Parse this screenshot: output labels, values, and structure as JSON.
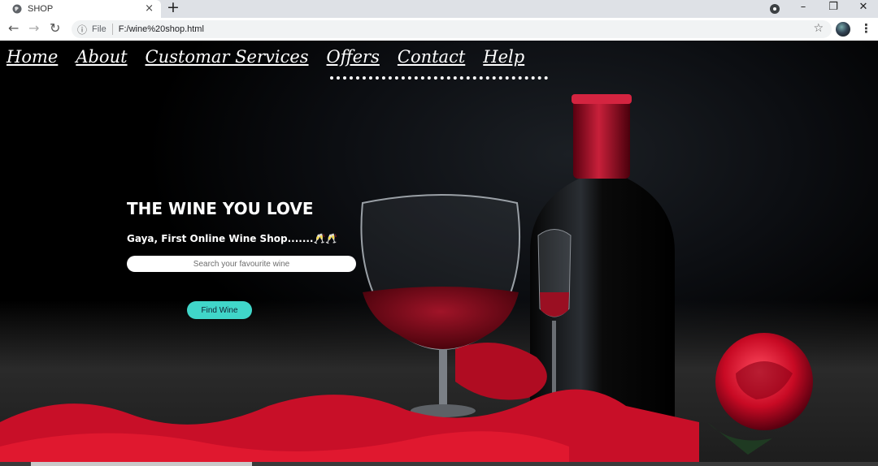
{
  "browser": {
    "tab_title": "SHOP",
    "tab_close": "×",
    "new_tab": "+",
    "controls": {
      "minimize": "–",
      "restore": "❐",
      "close": "✕"
    },
    "nav": {
      "back": "←",
      "forward": "→",
      "reload": "↻"
    },
    "address": {
      "info": "ⓘ",
      "scheme_label": "File",
      "url": "F:/wine%20shop.html"
    },
    "bookmark": "☆",
    "menu": "⋮"
  },
  "page": {
    "nav_links": [
      "Home",
      "About",
      "Customar Services",
      "Offers",
      "Contact",
      "Help"
    ],
    "hero": {
      "title": "THE WINE YOU LOVE",
      "subtitle": "Gaya, First Online Wine Shop.......🥂🥂",
      "search_placeholder": "Search your favourite wine",
      "button_label": "Find Wine"
    }
  },
  "colors": {
    "accent_button": "#40d6c9",
    "wine_red": "#8b0a1e",
    "silk_red": "#d0122a"
  }
}
